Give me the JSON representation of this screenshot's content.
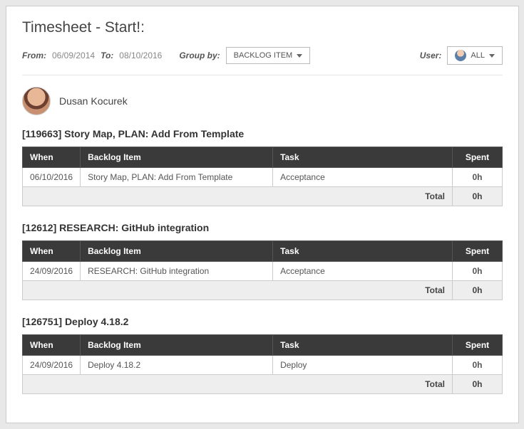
{
  "page_title": "Timesheet - Start!:",
  "filters": {
    "from_label": "From:",
    "from_value": "06/09/2014",
    "to_label": "To:",
    "to_value": "08/10/2016",
    "groupby_label": "Group by:",
    "groupby_value": "BACKLOG ITEM",
    "user_label": "User:",
    "user_value": "ALL"
  },
  "user": {
    "name": "Dusan Kocurek"
  },
  "columns": {
    "when": "When",
    "backlog_item": "Backlog Item",
    "task": "Task",
    "spent": "Spent"
  },
  "total_label": "Total",
  "sections": [
    {
      "id": "[119663]",
      "title": "Story Map, PLAN: Add From Template",
      "rows": [
        {
          "when": "06/10/2016",
          "backlog_item": "Story Map, PLAN: Add From Template",
          "task": "Acceptance",
          "spent": "0h"
        }
      ],
      "total": "0h"
    },
    {
      "id": "[12612]",
      "title": "RESEARCH: GitHub integration",
      "rows": [
        {
          "when": "24/09/2016",
          "backlog_item": "RESEARCH: GitHub integration",
          "task": "Acceptance",
          "spent": "0h"
        }
      ],
      "total": "0h"
    },
    {
      "id": "[126751]",
      "title": "Deploy 4.18.2",
      "rows": [
        {
          "when": "24/09/2016",
          "backlog_item": "Deploy 4.18.2",
          "task": "Deploy",
          "spent": "0h"
        }
      ],
      "total": "0h"
    }
  ]
}
